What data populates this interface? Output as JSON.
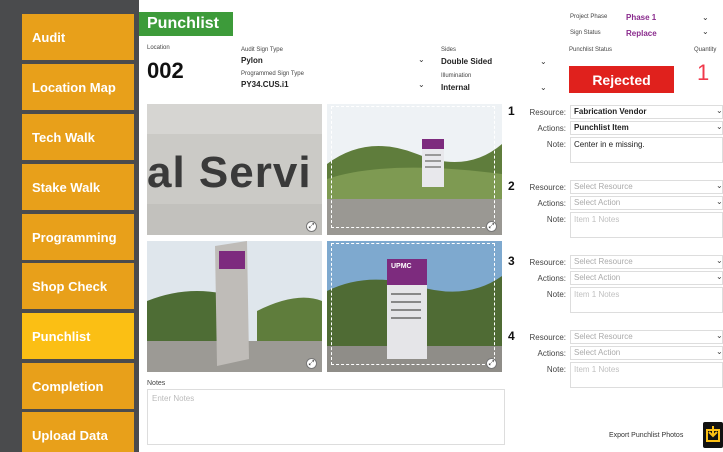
{
  "sidebar": {
    "items": [
      {
        "label": "Audit"
      },
      {
        "label": "Location Map"
      },
      {
        "label": "Tech Walk"
      },
      {
        "label": "Stake Walk"
      },
      {
        "label": "Programming"
      },
      {
        "label": "Shop Check"
      },
      {
        "label": "Punchlist",
        "active": true
      },
      {
        "label": "Completion"
      },
      {
        "label": "Upload Data"
      }
    ],
    "colors": {
      "bg": "#4a4b4d",
      "item": "#e8a01a",
      "active": "#fbbf14"
    }
  },
  "header": {
    "title": "Punchlist",
    "title_color": "#3d9b3a",
    "project_phase_label": "Project Phase",
    "project_phase_value": "Phase 1",
    "sign_status_label": "Sign Status",
    "sign_status_value": "Replace"
  },
  "info": {
    "location_label": "Location",
    "location_value": "002",
    "audit_sign_type_label": "Audit Sign Type",
    "audit_sign_type_value": "Pylon",
    "programmed_sign_type_label": "Programmed Sign Type",
    "programmed_sign_type_value": "PY34.CUS.i1",
    "sides_label": "Sides",
    "sides_value": "Double Sided",
    "illumination_label": "Illumination",
    "illumination_value": "Internal",
    "punchlist_status_label": "Punchlist Status",
    "punchlist_status_value": "Rejected",
    "quantity_label": "Quantity",
    "quantity_value": "1"
  },
  "photos": {
    "sign_text": "al Servi",
    "sign_tag": "UPMC"
  },
  "punch_items": [
    {
      "num": "1",
      "resource_label": "Resource:",
      "resource": "Fabrication Vendor",
      "actions_label": "Actions:",
      "action": "Punchlist Item",
      "note_label": "Note:",
      "note": "Center in e missing."
    },
    {
      "num": "2",
      "resource_label": "Resource:",
      "resource": "Select Resource",
      "actions_label": "Actions:",
      "action": "Select Action",
      "note_label": "Note:",
      "note": "Item 1 Notes"
    },
    {
      "num": "3",
      "resource_label": "Resource:",
      "resource": "Select Resource",
      "actions_label": "Actions:",
      "action": "Select Action",
      "note_label": "Note:",
      "note": "Item 1 Notes"
    },
    {
      "num": "4",
      "resource_label": "Resource:",
      "resource": "Select Resource",
      "actions_label": "Actions:",
      "action": "Select Action",
      "note_label": "Note:",
      "note": "Item 1 Notes"
    }
  ],
  "notes": {
    "label": "Notes",
    "placeholder": "Enter Notes"
  },
  "export": {
    "label": "Export Punchlist Photos"
  }
}
